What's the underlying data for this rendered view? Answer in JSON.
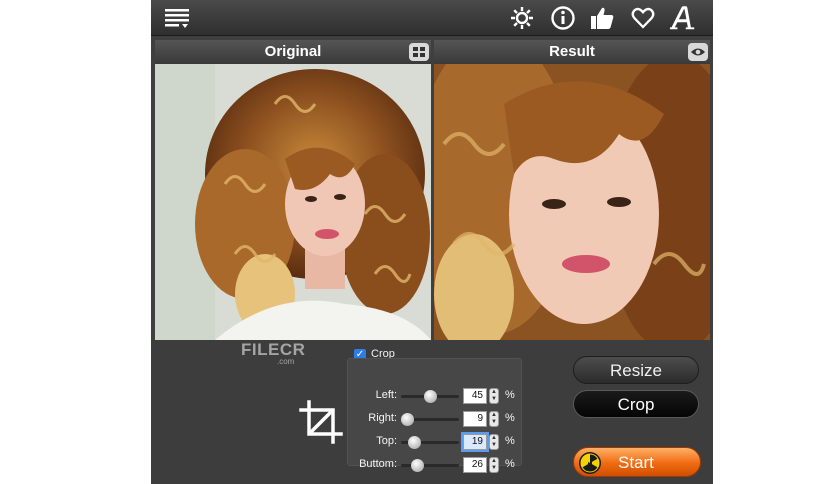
{
  "toolbar": {
    "icons": [
      "menu-icon",
      "gear-icon",
      "info-icon",
      "thumbs-up-icon",
      "heart-icon",
      "font-a-icon"
    ]
  },
  "panels": {
    "original_title": "Original",
    "result_title": "Result"
  },
  "controls": {
    "watermark": "FILECR",
    "watermark_sub": ".com",
    "crop_checkbox": {
      "label": "Crop",
      "checked": true
    },
    "params": [
      {
        "label": "Left:",
        "value": "45",
        "unit": "%",
        "slider_fraction": 0.5
      },
      {
        "label": "Right:",
        "value": "9",
        "unit": "%",
        "slider_fraction": 0.1
      },
      {
        "label": "Top:",
        "value": "19",
        "unit": "%",
        "slider_fraction": 0.22
      },
      {
        "label": "Buttom:",
        "value": "26",
        "unit": "%",
        "slider_fraction": 0.27
      }
    ],
    "resize_label": "Resize",
    "crop_label": "Crop",
    "start_label": "Start"
  },
  "colors": {
    "accent_orange": "#f06a12",
    "checkbox_blue": "#2d7de8",
    "background": "#3f3f3f"
  }
}
